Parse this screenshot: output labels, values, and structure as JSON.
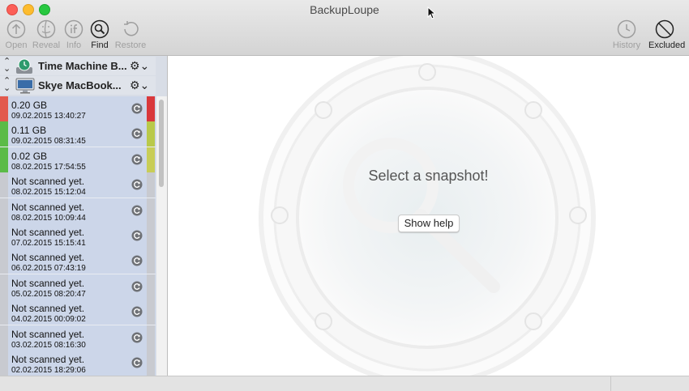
{
  "window": {
    "title": "BackupLoupe"
  },
  "toolbar": {
    "open_label": "Open",
    "reveal_label": "Reveal",
    "info_label": "Info",
    "find_label": "Find",
    "restore_label": "Restore",
    "history_label": "History",
    "excluded_label": "Excluded"
  },
  "sidebar": {
    "volumes": [
      {
        "name": "Time Machine B...",
        "icon": "time-machine-drive-icon"
      },
      {
        "name": "Skye MacBook...",
        "icon": "imac-icon"
      }
    ],
    "snapshots": [
      {
        "label": "0.20 GB",
        "date": "09.02.2015 13:40:27",
        "left_color": "#e25a4e",
        "right_color": "#d9383b"
      },
      {
        "label": "0.11 GB",
        "date": "09.02.2015 08:31:45",
        "left_color": "#5bbb47",
        "right_color": "#b9c94a"
      },
      {
        "label": "0.02 GB",
        "date": "08.02.2015 17:54:55",
        "left_color": "#5bbb47",
        "right_color": "#c8cd57"
      },
      {
        "label": "Not scanned yet.",
        "date": "08.02.2015 15:12:04",
        "left_color": "#c8cad0",
        "right_color": "#c8cad0"
      },
      {
        "label": "Not scanned yet.",
        "date": "08.02.2015 10:09:44",
        "left_color": "#c8cad0",
        "right_color": "#c8cad0"
      },
      {
        "label": "Not scanned yet.",
        "date": "07.02.2015 15:15:41",
        "left_color": "#c8cad0",
        "right_color": "#c8cad0"
      },
      {
        "label": "Not scanned yet.",
        "date": "06.02.2015 07:43:19",
        "left_color": "#c8cad0",
        "right_color": "#c8cad0"
      },
      {
        "label": "Not scanned yet.",
        "date": "05.02.2015 08:20:47",
        "left_color": "#c8cad0",
        "right_color": "#c8cad0"
      },
      {
        "label": "Not scanned yet.",
        "date": "04.02.2015 00:09:02",
        "left_color": "#c8cad0",
        "right_color": "#c8cad0"
      },
      {
        "label": "Not scanned yet.",
        "date": "03.02.2015 08:16:30",
        "left_color": "#c8cad0",
        "right_color": "#c8cad0"
      },
      {
        "label": "Not scanned yet.",
        "date": "02.02.2015 18:29:06",
        "left_color": "#c8cad0",
        "right_color": "#c8cad0"
      }
    ]
  },
  "main": {
    "hint": "Select a snapshot!",
    "help_button": "Show help"
  }
}
